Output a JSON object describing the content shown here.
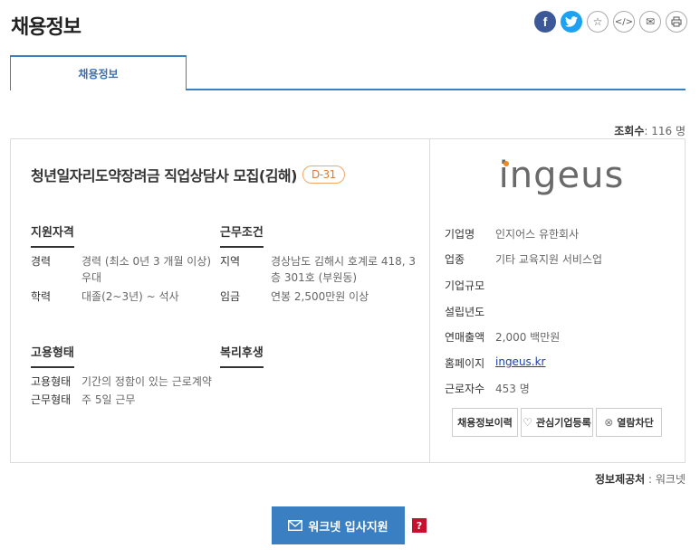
{
  "page": {
    "title": "채용정보"
  },
  "share": {
    "facebook": "f",
    "icons": [
      "facebook-icon",
      "twitter-icon",
      "star-icon",
      "code-icon",
      "mail-icon",
      "print-icon"
    ]
  },
  "tabs": [
    {
      "label": "채용정보",
      "active": true
    }
  ],
  "stats": {
    "view_label": "조회수",
    "view_value": ": 116 명"
  },
  "job": {
    "title": "청년일자리도약장려금 직업상담사 모집(김해)",
    "dday": "D-31",
    "qualifications": {
      "heading": "지원자격",
      "rows": [
        {
          "key": "경력",
          "value": "경력 (최소 0년 3 개월 이상) 우대"
        },
        {
          "key": "학력",
          "value": "대졸(2~3년) ~ 석사"
        }
      ]
    },
    "conditions": {
      "heading": "근무조건",
      "rows": [
        {
          "key": "지역",
          "value": "경상남도 김해시 호계로 418, 3층 301호 (부원동)"
        },
        {
          "key": "임금",
          "value": "연봉 2,500만원 이상"
        }
      ]
    },
    "employment": {
      "heading": "고용형태",
      "rows": [
        {
          "key": "고용형태",
          "value": "기간의 정함이 있는 근로계약"
        },
        {
          "key": "근무형태",
          "value": "주 5일 근무"
        }
      ]
    },
    "welfare": {
      "heading": "복리후생"
    }
  },
  "company": {
    "logo_text": "ingeus",
    "rows": [
      {
        "key": "기업명",
        "value": "인지어스 유한회사"
      },
      {
        "key": "업종",
        "value": "기타 교육지원 서비스업"
      },
      {
        "key": "기업규모",
        "value": ""
      },
      {
        "key": "설립년도",
        "value": ""
      },
      {
        "key": "연매출액",
        "value": "2,000 백만원"
      },
      {
        "key": "홈페이지",
        "value": "ingeus.kr"
      },
      {
        "key": "근로자수",
        "value": "453 명"
      }
    ],
    "buttons": {
      "history": "채용정보이력",
      "favorite": "관심기업등록",
      "block": "열람차단"
    }
  },
  "footer": {
    "provider_label": "정보제공처",
    "provider_value": " : 워크넷",
    "apply_label": "워크넷 입사지원",
    "help": "?"
  },
  "colors": {
    "accent": "#3a7fc1",
    "dday": "#e07a2c",
    "help": "#c8102e",
    "logo_dot": "#f08a1d"
  }
}
